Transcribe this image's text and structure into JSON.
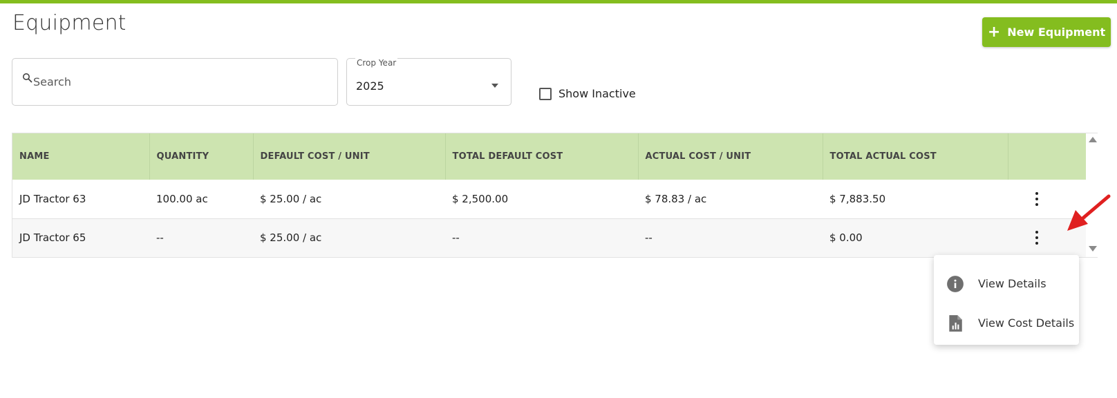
{
  "header": {
    "title": "Equipment",
    "new_button_label": "New Equipment",
    "accent_color": "#84bd1f"
  },
  "filters": {
    "search_placeholder": "Search",
    "crop_year_label": "Crop Year",
    "crop_year_value": "2025",
    "show_inactive_label": "Show Inactive"
  },
  "table": {
    "header_color": "#cde4b0",
    "columns": [
      "NAME",
      "QUANTITY",
      "DEFAULT COST / UNIT",
      "TOTAL DEFAULT COST",
      "ACTUAL COST / UNIT",
      "TOTAL ACTUAL COST"
    ],
    "rows": [
      {
        "name": "JD Tractor 63",
        "quantity": "100.00 ac",
        "default_cost_unit": "$ 25.00 / ac",
        "total_default_cost": "$ 2,500.00",
        "actual_cost_unit": "$ 78.83 / ac",
        "total_actual_cost": "$ 7,883.50"
      },
      {
        "name": "JD Tractor 65",
        "quantity": "--",
        "default_cost_unit": "$ 25.00 / ac",
        "total_default_cost": "--",
        "actual_cost_unit": "--",
        "total_actual_cost": "$ 0.00"
      }
    ]
  },
  "context_menu": {
    "items": [
      {
        "label": "View Details",
        "icon": "info-icon"
      },
      {
        "label": "View Cost Details",
        "icon": "report-icon"
      }
    ]
  }
}
